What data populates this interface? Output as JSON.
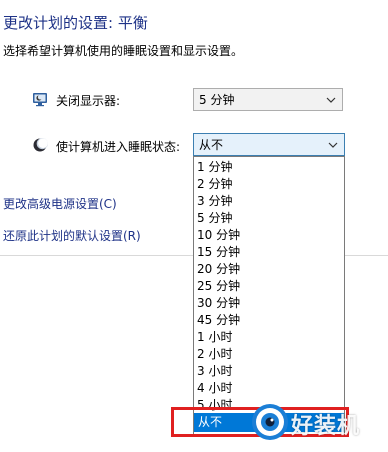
{
  "header": {
    "title": "更改计划的设置: 平衡",
    "subtitle": "选择希望计算机使用的睡眠设置和显示设置。"
  },
  "settings": {
    "display_off": {
      "label": "关闭显示器:",
      "value": "5 分钟",
      "icon": "monitor-moon-icon"
    },
    "sleep": {
      "label": "使计算机进入睡眠状态:",
      "value": "从不",
      "icon": "moon-icon"
    }
  },
  "links": {
    "advanced": "更改高级电源设置(C)",
    "restore": "还原此计划的默认设置(R)"
  },
  "dropdown": {
    "options": [
      "1 分钟",
      "2 分钟",
      "3 分钟",
      "5 分钟",
      "10 分钟",
      "15 分钟",
      "20 分钟",
      "25 分钟",
      "30 分钟",
      "45 分钟",
      "1 小时",
      "2 小时",
      "3 小时",
      "4 小时",
      "5 小时"
    ],
    "selected": "从不"
  },
  "watermark": {
    "text": "好装机"
  },
  "colors": {
    "title": "#1e3287",
    "link": "#1e3287",
    "selection": "#0078d7",
    "highlight_box": "#e02020"
  }
}
